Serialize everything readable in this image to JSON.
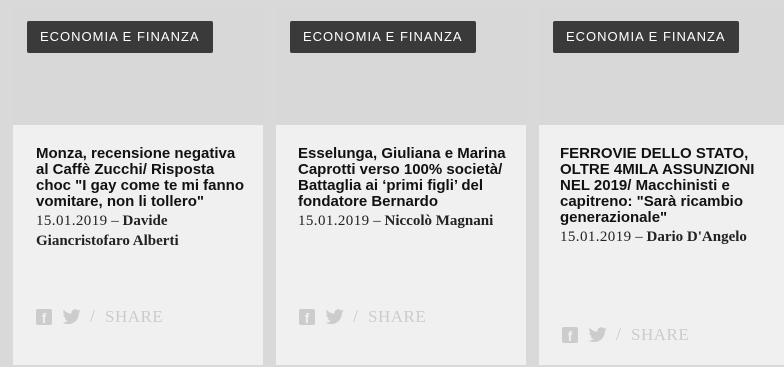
{
  "cards": [
    {
      "category": "ECONOMIA E FINANZA",
      "title": "Monza, recensione negativa al Caffè Zucchi/ Risposta choc \"I gay come te mi fanno vomitare, non li tollero\"",
      "date": "15.01.2019",
      "dash": "–",
      "author": "Davide Giancristofaro Alberti",
      "share_sep": "/",
      "share_label": "SHARE"
    },
    {
      "category": "ECONOMIA E FINANZA",
      "title": "Esselunga, Giuliana e Marina Caprotti verso 100% società/ Battaglia ai ‘primi figli’ del fondatore Bernardo",
      "date": "15.01.2019",
      "dash": "–",
      "author": "Niccolò Magnani",
      "share_sep": "/",
      "share_label": "SHARE"
    },
    {
      "category": "ECONOMIA E FINANZA",
      "title": "FERROVIE DELLO STATO, OLTRE 4MILA ASSUNZIONI NEL 2019/ Macchinisti e capitreno: \"Sarà ricambio generazionale\"",
      "date": "15.01.2019",
      "dash": "–",
      "author": "Dario D'Angelo",
      "share_sep": "/",
      "share_label": "SHARE"
    }
  ],
  "icons": {
    "facebook": "facebook-icon",
    "twitter": "twitter-icon"
  },
  "colors": {
    "badge_bg": "#3a3a3a",
    "card_bg": "#f0f0f0",
    "image_placeholder": "#d8d8d8",
    "share_gray": "#cccccc"
  }
}
